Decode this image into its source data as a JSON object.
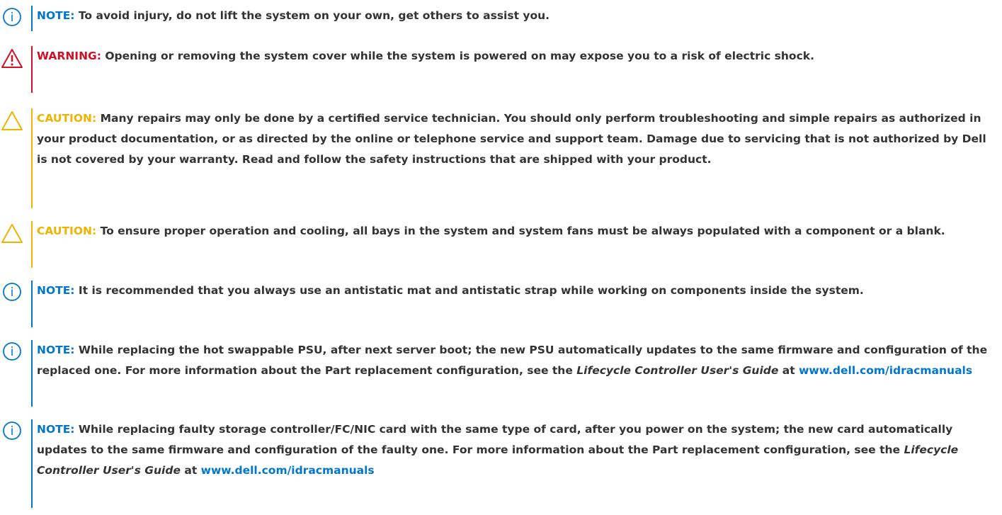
{
  "colors": {
    "note": "#0076ce",
    "warning": "#ce1126",
    "caution": "#f0b400",
    "text": "#333333"
  },
  "notes": [
    {
      "kind": "note",
      "icon": "info-circle-icon",
      "label": "NOTE:",
      "text": "To avoid injury, do not lift the system on your own, get others to assist you."
    },
    {
      "kind": "warning",
      "icon": "warning-triangle-icon",
      "label": "WARNING:",
      "text": "Opening or removing the system cover while the system is powered on may expose you to a risk of electric shock."
    },
    {
      "kind": "caution",
      "icon": "caution-triangle-icon",
      "label": "CAUTION:",
      "text": "Many repairs may only be done by a certified service technician. You should only perform troubleshooting and simple repairs as authorized in your product documentation, or as directed by the online or telephone service and support team. Damage due to servicing that is not authorized by Dell is not covered by your warranty. Read and follow the safety instructions that are shipped with your product."
    },
    {
      "kind": "caution",
      "icon": "caution-triangle-icon",
      "label": "CAUTION:",
      "text": "To ensure proper operation and cooling, all bays in the system and system fans must be always populated with a component or a blank."
    },
    {
      "kind": "note",
      "icon": "info-circle-icon",
      "label": "NOTE:",
      "text": "It is recommended that you always use an antistatic mat and antistatic strap while working on components inside the system."
    },
    {
      "kind": "note",
      "icon": "info-circle-icon",
      "label": "NOTE:",
      "text": "While replacing the hot swappable PSU, after next server boot; the new PSU automatically updates to the same firmware and configuration of the replaced one. For more information about the Part replacement configuration, see the",
      "guide": "Lifecycle Controller User's Guide",
      "at": "at",
      "link": "www.dell.com/idracmanuals"
    },
    {
      "kind": "note",
      "icon": "info-circle-icon",
      "label": "NOTE:",
      "text": "While replacing faulty storage controller/FC/NIC card with the same type of card, after you power on the system; the new card automatically updates to the same firmware and configuration of the faulty one. For more information about the Part replacement configuration, see the",
      "guide": "Lifecycle Controller User's Guide",
      "at": "at",
      "link": "www.dell.com/idracmanuals"
    }
  ]
}
